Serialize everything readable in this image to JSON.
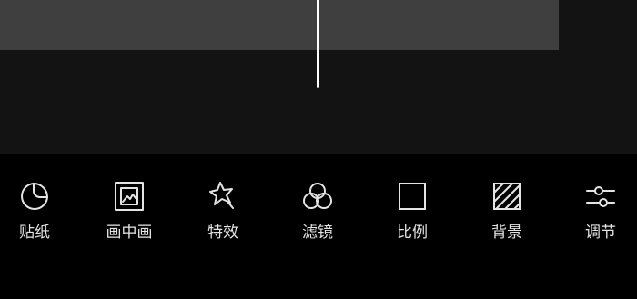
{
  "colors": {
    "toolbar_background": "#000000",
    "timeline_background": "#131313",
    "video_track": "#3f3f3f",
    "playhead": "#ffffff",
    "icon_stroke": "#e4e4e4",
    "label_text": "#e4e4e4"
  },
  "toolbar": {
    "items": [
      {
        "label": "贴纸",
        "icon": "sticker-icon"
      },
      {
        "label": "画中画",
        "icon": "picture-in-picture-icon"
      },
      {
        "label": "特效",
        "icon": "effects-star-icon"
      },
      {
        "label": "滤镜",
        "icon": "filter-circles-icon"
      },
      {
        "label": "比例",
        "icon": "aspect-ratio-square-icon"
      },
      {
        "label": "背景",
        "icon": "background-hatched-icon"
      },
      {
        "label": "调节",
        "icon": "adjust-sliders-icon"
      }
    ]
  }
}
